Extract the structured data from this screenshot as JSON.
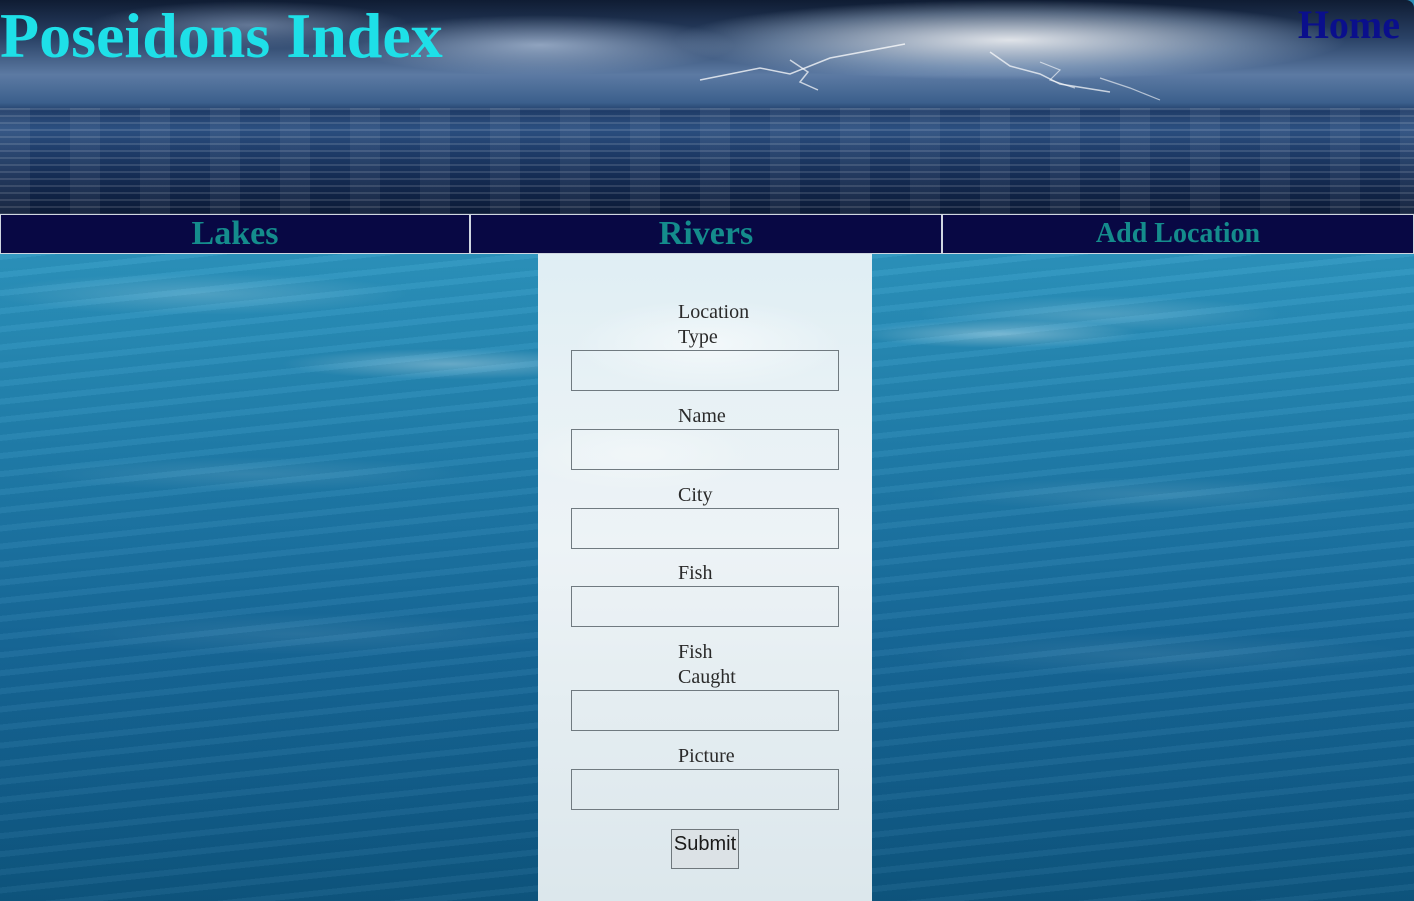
{
  "header": {
    "title": "Poseidons Index",
    "home_link": "Home"
  },
  "nav": {
    "items": [
      {
        "label": "Lakes"
      },
      {
        "label": "Rivers"
      },
      {
        "label": "Add Location"
      }
    ]
  },
  "form": {
    "fields": [
      {
        "label": "Location Type",
        "value": "",
        "placeholder": ""
      },
      {
        "label": "Name",
        "value": "",
        "placeholder": ""
      },
      {
        "label": "City",
        "value": "",
        "placeholder": ""
      },
      {
        "label": "Fish",
        "value": "",
        "placeholder": ""
      },
      {
        "label": "Fish Caught",
        "value": "",
        "placeholder": ""
      },
      {
        "label": "Picture",
        "value": "",
        "placeholder": ""
      }
    ],
    "submit_label": "Submit"
  },
  "colors": {
    "title": "#1ee0e8",
    "home_link": "#0a0f8c",
    "nav_background": "#080844",
    "nav_text": "#148c8c"
  }
}
